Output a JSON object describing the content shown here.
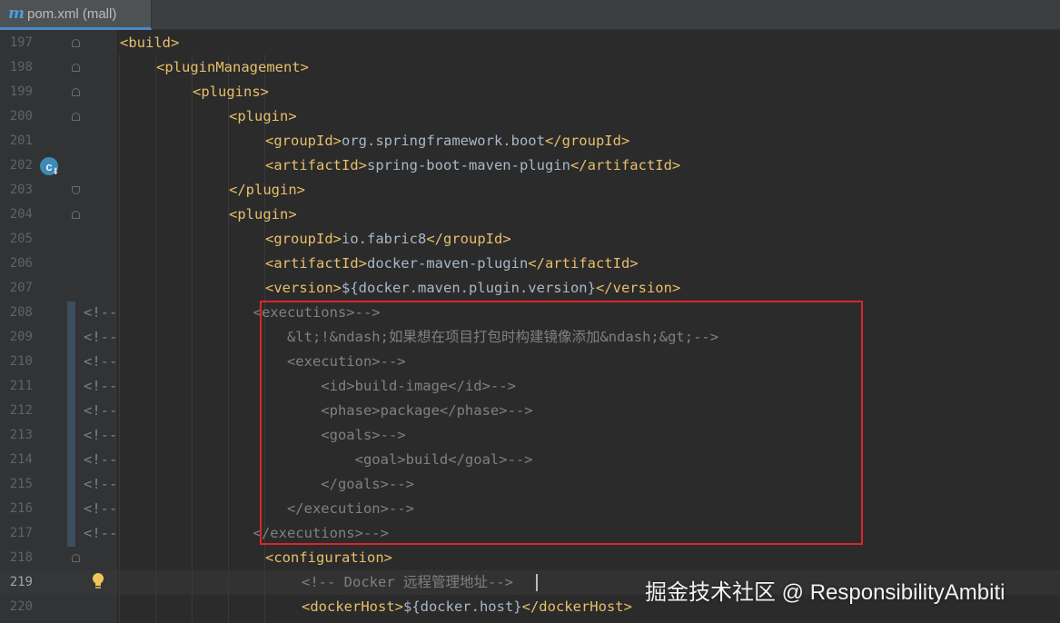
{
  "tab": {
    "icon": "maven-m-icon",
    "icon_glyph": "m",
    "label": "pom.xml (mall)"
  },
  "watermark": "掘金技术社区 @ ResponsibilityAmbiti",
  "lines": [
    {
      "num": "197",
      "tokens": [
        {
          "t": "tag",
          "v": "<build>"
        }
      ]
    },
    {
      "num": "198",
      "tokens": [
        {
          "t": "tag",
          "v": "<pluginManagement>"
        }
      ]
    },
    {
      "num": "199",
      "tokens": [
        {
          "t": "tag",
          "v": "<plugins>"
        }
      ]
    },
    {
      "num": "200",
      "tokens": [
        {
          "t": "tag",
          "v": "<plugin>"
        }
      ]
    },
    {
      "num": "201",
      "tokens": [
        {
          "t": "tag",
          "v": "<groupId>"
        },
        {
          "t": "txt",
          "v": "org.springframework.boot"
        },
        {
          "t": "tag",
          "v": "</groupId>"
        }
      ]
    },
    {
      "num": "202",
      "tokens": [
        {
          "t": "tag",
          "v": "<artifactId>"
        },
        {
          "t": "txt",
          "v": "spring-boot-maven-plugin"
        },
        {
          "t": "tag",
          "v": "</artifactId>"
        }
      ]
    },
    {
      "num": "203",
      "tokens": [
        {
          "t": "tag",
          "v": "</plugin>"
        }
      ]
    },
    {
      "num": "204",
      "tokens": [
        {
          "t": "tag",
          "v": "<plugin>"
        }
      ]
    },
    {
      "num": "205",
      "tokens": [
        {
          "t": "tag",
          "v": "<groupId>"
        },
        {
          "t": "txt",
          "v": "io.fabric8"
        },
        {
          "t": "tag",
          "v": "</groupId>"
        }
      ]
    },
    {
      "num": "206",
      "tokens": [
        {
          "t": "tag",
          "v": "<artifactId>"
        },
        {
          "t": "txt",
          "v": "docker-maven-plugin"
        },
        {
          "t": "tag",
          "v": "</artifactId>"
        }
      ]
    },
    {
      "num": "207",
      "tokens": [
        {
          "t": "tag",
          "v": "<version>"
        },
        {
          "t": "txt",
          "v": "${docker.maven.plugin.version}"
        },
        {
          "t": "tag",
          "v": "</version>"
        }
      ]
    },
    {
      "num": "208",
      "tokens": [
        {
          "t": "cm",
          "v": "<!--                <executions>-->"
        }
      ]
    },
    {
      "num": "209",
      "tokens": [
        {
          "t": "cm",
          "v": "<!--                    &lt;!&ndash;如果想在项目打包时构建镜像添加&ndash;&gt;-->"
        }
      ]
    },
    {
      "num": "210",
      "tokens": [
        {
          "t": "cm",
          "v": "<!--                    <execution>-->"
        }
      ]
    },
    {
      "num": "211",
      "tokens": [
        {
          "t": "cm",
          "v": "<!--                        <id>build-image</id>-->"
        }
      ]
    },
    {
      "num": "212",
      "tokens": [
        {
          "t": "cm",
          "v": "<!--                        <phase>package</phase>-->"
        }
      ]
    },
    {
      "num": "213",
      "tokens": [
        {
          "t": "cm",
          "v": "<!--                        <goals>-->"
        }
      ]
    },
    {
      "num": "214",
      "tokens": [
        {
          "t": "cm",
          "v": "<!--                            <goal>build</goal>-->"
        }
      ]
    },
    {
      "num": "215",
      "tokens": [
        {
          "t": "cm",
          "v": "<!--                        </goals>-->"
        }
      ]
    },
    {
      "num": "216",
      "tokens": [
        {
          "t": "cm",
          "v": "<!--                    </execution>-->"
        }
      ]
    },
    {
      "num": "217",
      "tokens": [
        {
          "t": "cm",
          "v": "<!--                </executions>-->"
        }
      ]
    },
    {
      "num": "218",
      "tokens": [
        {
          "t": "tag",
          "v": "<configuration>"
        }
      ]
    },
    {
      "num": "219",
      "tokens": [
        {
          "t": "cm",
          "v": "<!-- Docker 远程管理地址-->"
        }
      ]
    },
    {
      "num": "220",
      "tokens": [
        {
          "t": "tag",
          "v": "<dockerHost>"
        },
        {
          "t": "txt",
          "v": "${docker.host}"
        },
        {
          "t": "tag",
          "v": "</dockerHost>"
        }
      ]
    }
  ]
}
